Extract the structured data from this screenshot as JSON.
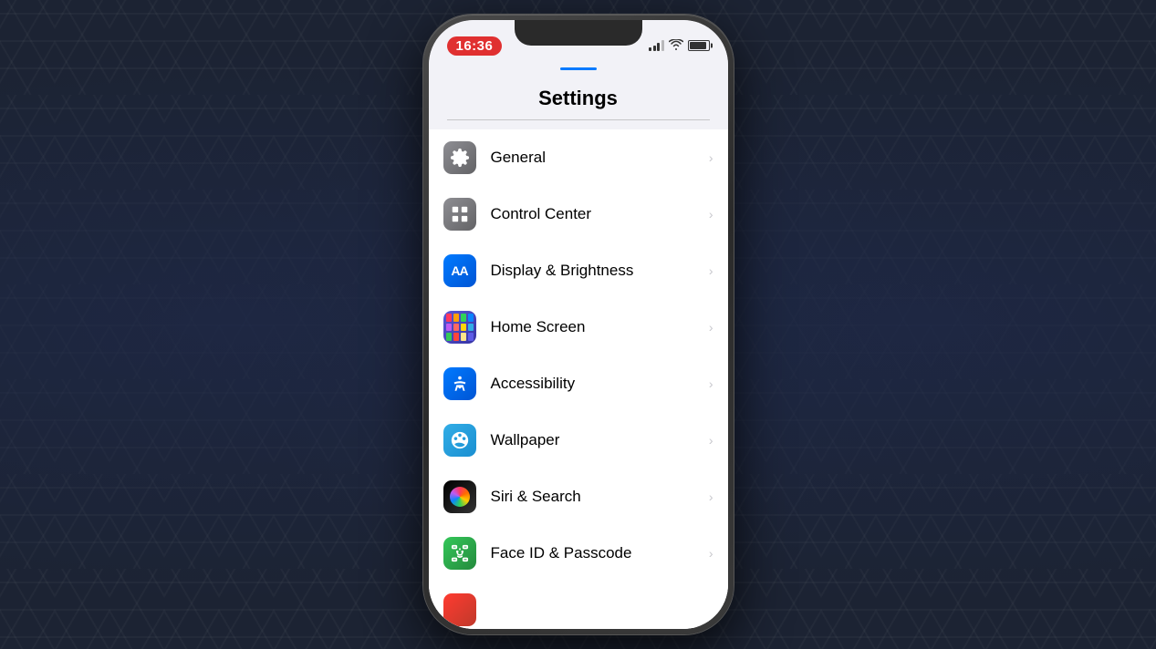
{
  "background": {
    "color": "#1c2333"
  },
  "phone": {
    "time": "16:36",
    "screen_title": "Settings",
    "settings_items": [
      {
        "id": "general",
        "label": "General",
        "icon_type": "general",
        "icon_char": "⚙"
      },
      {
        "id": "control-center",
        "label": "Control Center",
        "icon_type": "control",
        "icon_char": "⊞"
      },
      {
        "id": "display-brightness",
        "label": "Display & Brightness",
        "icon_type": "display",
        "icon_char": "AA"
      },
      {
        "id": "home-screen",
        "label": "Home Screen",
        "icon_type": "homescreen",
        "icon_char": "⊞"
      },
      {
        "id": "accessibility",
        "label": "Accessibility",
        "icon_type": "accessibility",
        "icon_char": "♿"
      },
      {
        "id": "wallpaper",
        "label": "Wallpaper",
        "icon_type": "wallpaper",
        "icon_char": "❋"
      },
      {
        "id": "siri-search",
        "label": "Siri & Search",
        "icon_type": "siri",
        "icon_char": "◎"
      },
      {
        "id": "face-id",
        "label": "Face ID & Passcode",
        "icon_type": "faceid",
        "icon_char": "☺"
      }
    ],
    "chevron": "›"
  }
}
